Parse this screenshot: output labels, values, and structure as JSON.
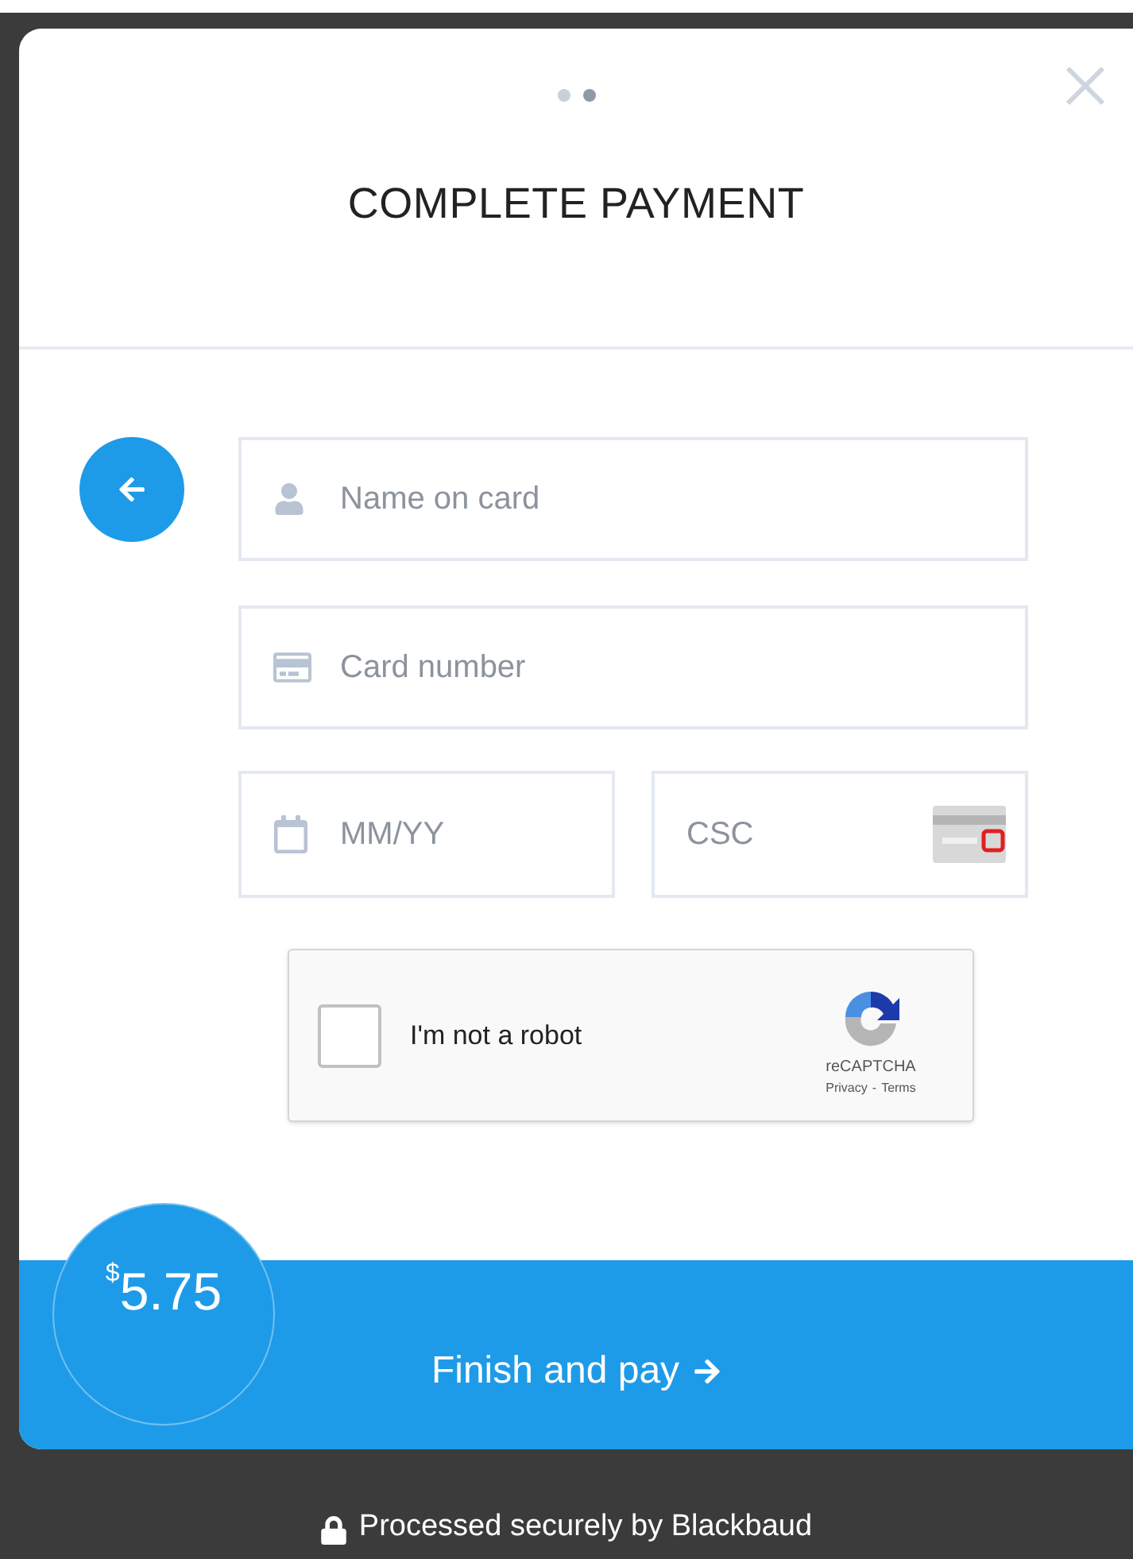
{
  "steps": [
    {
      "selected": false
    },
    {
      "selected": true
    }
  ],
  "title": "COMPLETE PAYMENT",
  "fields": [
    {
      "kind": "name",
      "placeholder": "Name on card"
    },
    {
      "kind": "card",
      "placeholder": "Card number"
    },
    {
      "kind": "expiry",
      "placeholder": "MM/YY"
    },
    {
      "kind": "csc",
      "placeholder": "CSC"
    }
  ],
  "captcha": {
    "checked": false,
    "label": "I'm not a robot",
    "brand": "reCAPTCHA",
    "privacy": "Privacy",
    "separator": "-",
    "terms": "Terms"
  },
  "price": {
    "currency": "$",
    "amount": "5.75"
  },
  "submit": "Finish and pay",
  "footer": "Processed securely by Blackbaud"
}
